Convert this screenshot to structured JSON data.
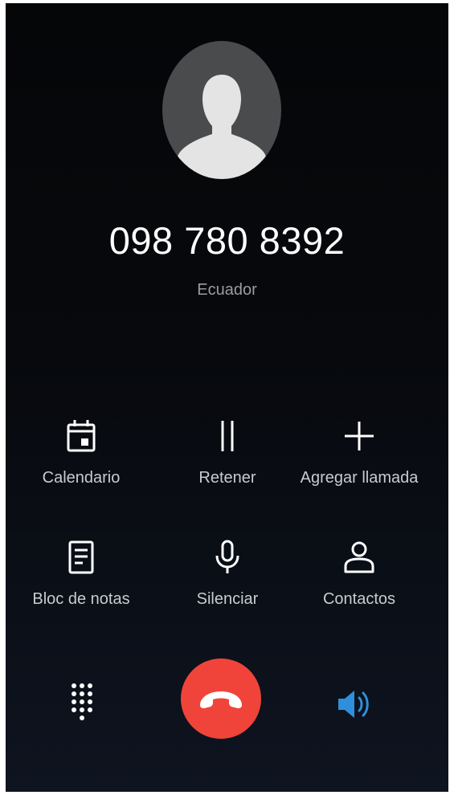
{
  "call": {
    "number": "098 780 8392",
    "location": "Ecuador"
  },
  "actions": [
    {
      "label": "Calendario",
      "icon": "calendar-icon"
    },
    {
      "label": "Retener",
      "icon": "pause-icon"
    },
    {
      "label": "Agregar llamada",
      "icon": "plus-icon"
    },
    {
      "label": "Bloc de notas",
      "icon": "notepad-icon"
    },
    {
      "label": "Silenciar",
      "icon": "microphone-icon"
    },
    {
      "label": "Contactos",
      "icon": "contact-person-icon"
    }
  ],
  "controls": {
    "dialpad_icon": "dialpad-icon",
    "end_call_icon": "hang-up-icon",
    "speaker_icon": "speaker-icon"
  },
  "colors": {
    "end_call": "#f0443a",
    "speaker_active": "#2f8fdc",
    "label": "#c9cbcf",
    "icon": "#ffffff"
  }
}
